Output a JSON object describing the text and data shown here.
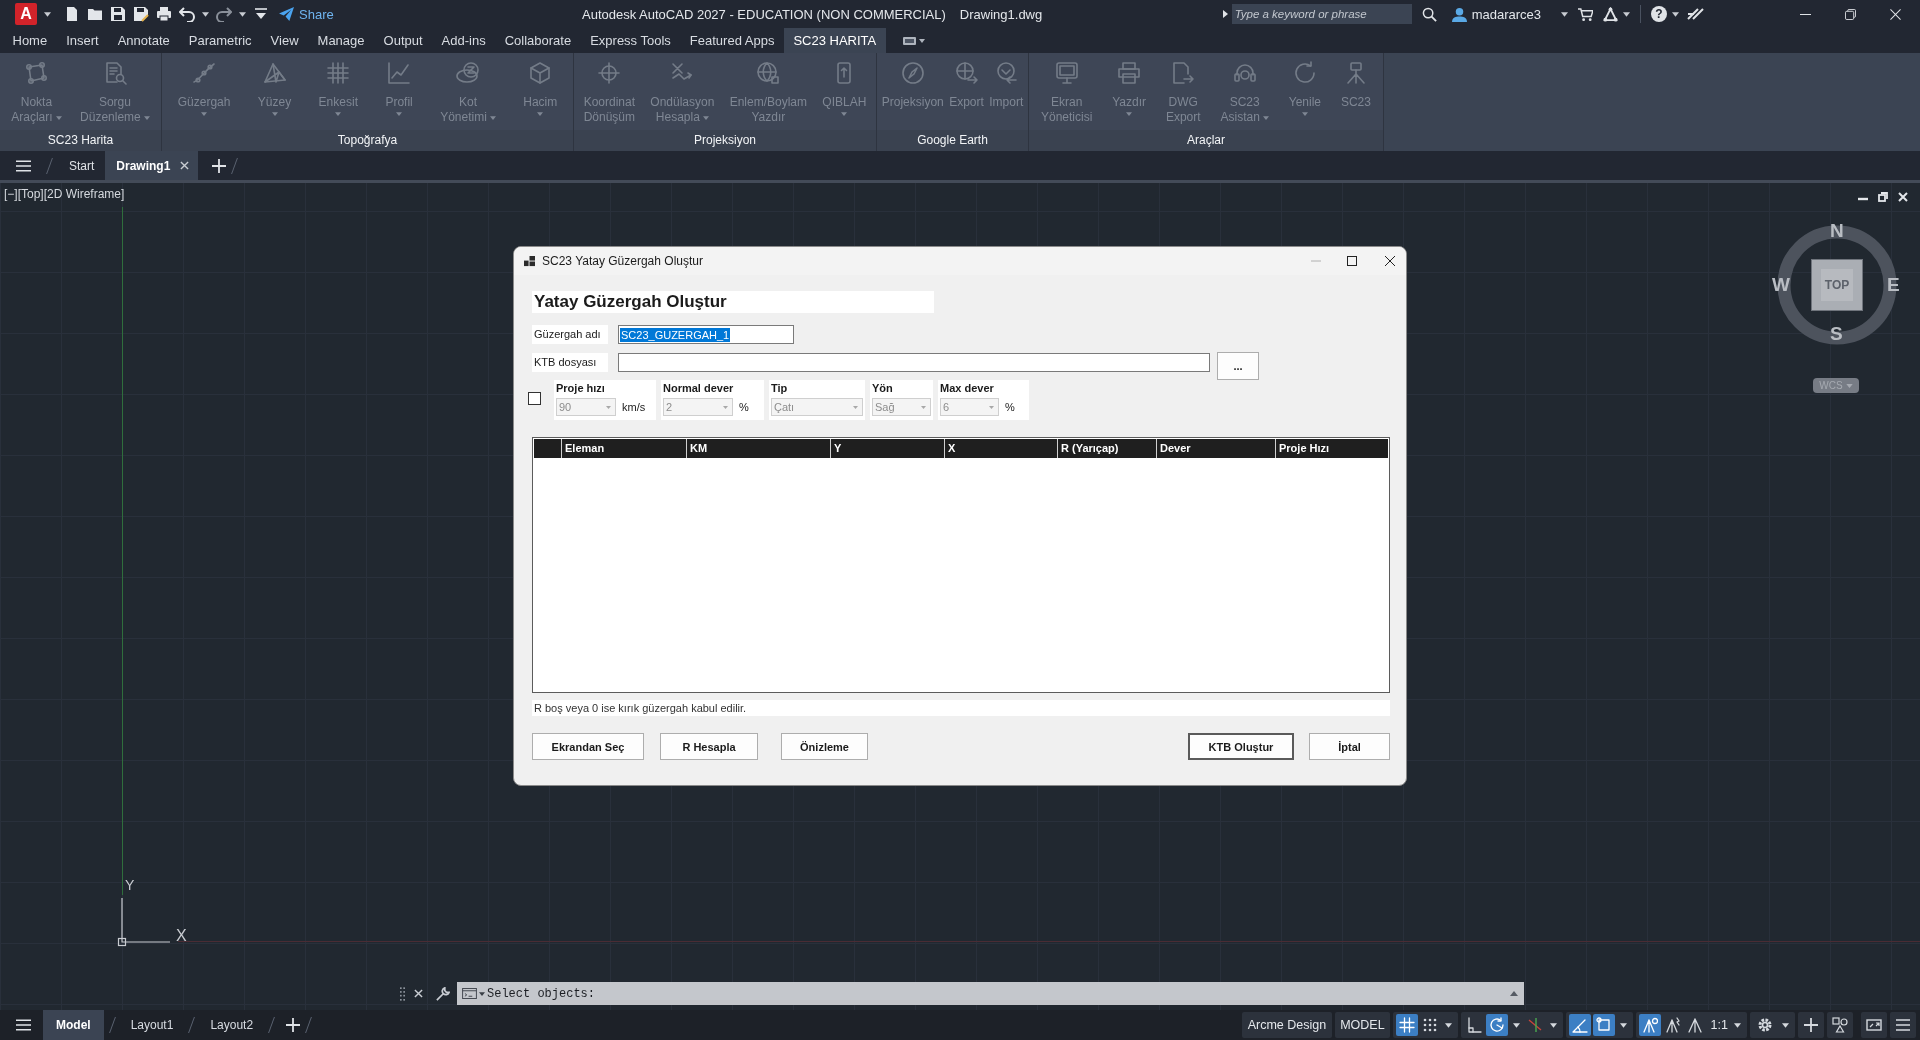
{
  "titlebar": {
    "logo": "A",
    "share": "Share",
    "app_title": "Autodesk AutoCAD 2027 - EDUCATION (NON COMMERCIAL)",
    "file_name": "Drawing1.dwg",
    "search": {
      "placeholder": "Type a keyword or phrase"
    },
    "user": "madararce3",
    "help": "?"
  },
  "ribbon": {
    "tabs": [
      {
        "label": "Home",
        "selected": false
      },
      {
        "label": "Insert",
        "selected": false
      },
      {
        "label": "Annotate",
        "selected": false
      },
      {
        "label": "Parametric",
        "selected": false
      },
      {
        "label": "View",
        "selected": false
      },
      {
        "label": "Manage",
        "selected": false
      },
      {
        "label": "Output",
        "selected": false
      },
      {
        "label": "Add-ins",
        "selected": false
      },
      {
        "label": "Collaborate",
        "selected": false
      },
      {
        "label": "Express Tools",
        "selected": false
      },
      {
        "label": "Featured Apps",
        "selected": false
      },
      {
        "label": "SC23 HARITA",
        "selected": true
      }
    ],
    "panels": [
      {
        "title": "SC23 Harita",
        "items": [
          {
            "label": "Nokta Araçları",
            "kind": "inline",
            "disabled": true
          },
          {
            "label": "Sorgu Düzenleme",
            "kind": "inline",
            "disabled": true
          }
        ]
      },
      {
        "title": "Topoğrafya",
        "items": [
          {
            "label": "Güzergah",
            "kind": "stacked",
            "disabled": true
          },
          {
            "label": "Yüzey",
            "kind": "stacked",
            "disabled": true
          },
          {
            "label": "Enkesit",
            "kind": "stacked",
            "disabled": true
          },
          {
            "label": "Profil",
            "kind": "stacked",
            "disabled": true
          },
          {
            "label": "Kot Yönetimi",
            "kind": "inline",
            "disabled": true
          },
          {
            "label": "Hacim",
            "kind": "stacked",
            "disabled": true
          }
        ]
      },
      {
        "title": "Projeksiyon",
        "items": [
          {
            "label": "Koordinat Dönüşüm",
            "kind": "plain",
            "disabled": true
          },
          {
            "label": "Ondülasyon Hesapla",
            "kind": "inline",
            "disabled": true
          },
          {
            "label": "Enlem/Boylam Yazdır",
            "kind": "plain",
            "disabled": true
          },
          {
            "label": "QIBLAH",
            "kind": "stacked",
            "disabled": true
          }
        ]
      },
      {
        "title": "Google Earth",
        "items": [
          {
            "label": "Projeksiyon",
            "kind": "plain",
            "disabled": true
          },
          {
            "label": "Export",
            "kind": "plain",
            "disabled": true
          },
          {
            "label": "Import",
            "kind": "plain",
            "disabled": true
          }
        ]
      },
      {
        "title": "Araçlar",
        "items": [
          {
            "label": "Ekran Yöneticisi",
            "kind": "plain",
            "disabled": true
          },
          {
            "label": "Yazdır",
            "kind": "stacked",
            "disabled": true
          },
          {
            "label": "DWG Export",
            "kind": "plain",
            "disabled": true
          },
          {
            "label": "SC23 Asistan",
            "kind": "inline",
            "disabled": true
          },
          {
            "label": "Yenile",
            "kind": "stacked",
            "disabled": true
          },
          {
            "label": "SC23",
            "kind": "plain",
            "disabled": true
          }
        ]
      }
    ]
  },
  "file_tabs": [
    {
      "label": "Start",
      "selected": false
    },
    {
      "label": "Drawing1",
      "selected": true
    }
  ],
  "viewport": {
    "label": "[−][Top][2D Wireframe]",
    "viewcube": {
      "top": "TOP",
      "north": "N",
      "south": "S",
      "east": "E",
      "west": "W",
      "ucs": "WCS"
    },
    "ucs_icon": {
      "x": "X",
      "y": "Y"
    }
  },
  "dialog": {
    "title": "SC23 Yatay Güzergah Oluştur",
    "heading": "Yatay Güzergah Oluştur",
    "route_name": {
      "label": "Güzergah adı",
      "value": "SC23_GUZERGAH_1",
      "selected": true
    },
    "ktb_file": {
      "label": "KTB dosyası",
      "browse": "..."
    },
    "options": {
      "checkbox": {
        "checked": false
      },
      "groups": [
        {
          "label": "Proje hızı",
          "value": "90",
          "unit": "km/s",
          "disabled": true
        },
        {
          "label": "Normal dever",
          "value": "2",
          "unit": "%",
          "disabled": true
        },
        {
          "label": "Tip",
          "value": "Çatı",
          "disabled": true
        },
        {
          "label": "Yön",
          "value": "Sağ",
          "disabled": true
        },
        {
          "label": "Max dever",
          "value": "6",
          "unit": "%",
          "disabled": true
        }
      ]
    },
    "table": {
      "columns": [
        "Eleman",
        "KM",
        "Y",
        "X",
        "R (Yarıçap)",
        "Dever",
        "Proje Hızı"
      ]
    },
    "note": "R boş veya 0 ise kırık güzergah kabul edilir.",
    "buttons": [
      {
        "label": "Ekrandan Seç",
        "default": false
      },
      {
        "label": "R Hesapla",
        "default": false
      },
      {
        "label": "Önizleme",
        "default": false
      }
    ],
    "actions": [
      {
        "label": "KTB Oluştur",
        "default": true
      },
      {
        "label": "İptal",
        "default": false
      }
    ]
  },
  "command_line": {
    "prompt": "Select objects:"
  },
  "status_bar": {
    "layouts": [
      {
        "label": "Model",
        "selected": true
      },
      {
        "label": "Layout1",
        "selected": false
      },
      {
        "label": "Layout2",
        "selected": false
      }
    ],
    "workspace": "Arcme Design",
    "space": "MODEL",
    "toggles": [
      {
        "kind": "single",
        "on": true
      },
      {
        "kind": "split",
        "on": false
      },
      {
        "kind": "single",
        "on": false
      },
      {
        "kind": "split",
        "on": true
      },
      {
        "kind": "split",
        "on": false
      },
      {
        "kind": "single",
        "on": true
      },
      {
        "kind": "split",
        "on": true
      },
      {
        "kind": "single",
        "on": true
      },
      {
        "kind": "single",
        "on": false
      },
      {
        "kind": "single",
        "on": false
      }
    ],
    "scale": "1:1"
  }
}
